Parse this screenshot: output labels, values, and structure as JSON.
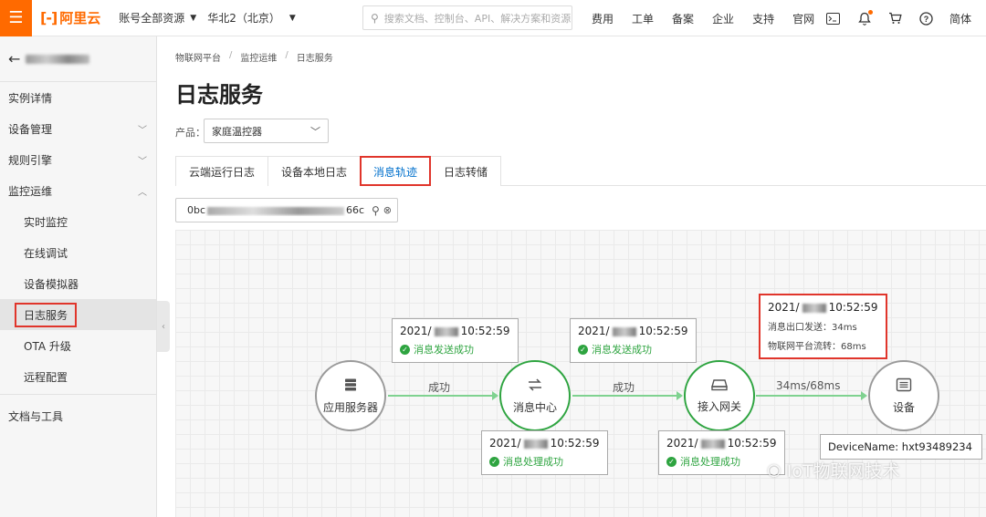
{
  "topbar": {
    "menu_icon": "hamburger-icon",
    "brand": "阿里云",
    "account_scope": "账号全部资源",
    "region": "华北2（北京）",
    "search_placeholder": "搜索文档、控制台、API、解决方案和资源",
    "links": [
      "费用",
      "工单",
      "备案",
      "企业",
      "支持",
      "官网"
    ],
    "icons": [
      "terminal-icon",
      "bell-icon",
      "cart-icon",
      "help-icon"
    ],
    "language": "简体",
    "accent": "#ff6a00"
  },
  "sidebar": {
    "back_icon": "arrow-left-icon",
    "items": [
      {
        "label": "实例详情",
        "level": 1,
        "expandable": false
      },
      {
        "label": "设备管理",
        "level": 1,
        "expandable": true,
        "expanded": false
      },
      {
        "label": "规则引擎",
        "level": 1,
        "expandable": true,
        "expanded": false
      },
      {
        "label": "监控运维",
        "level": 1,
        "expandable": true,
        "expanded": true
      },
      {
        "label": "实时监控",
        "level": 2
      },
      {
        "label": "在线调试",
        "level": 2
      },
      {
        "label": "设备模拟器",
        "level": 2
      },
      {
        "label": "日志服务",
        "level": 2,
        "active": true
      },
      {
        "label": "OTA 升级",
        "level": 2
      },
      {
        "label": "远程配置",
        "level": 2
      },
      {
        "label": "文档与工具",
        "level": 1,
        "expandable": false
      }
    ]
  },
  "breadcrumb": [
    "物联网平台",
    "监控运维",
    "日志服务"
  ],
  "page": {
    "title": "日志服务",
    "product_label": "产品：",
    "product_value": "家庭温控器",
    "tabs": [
      {
        "label": "云端运行日志",
        "active": false
      },
      {
        "label": "设备本地日志",
        "active": false
      },
      {
        "label": "消息轨迹",
        "active": true
      },
      {
        "label": "日志转储",
        "active": false
      }
    ],
    "trace_id_prefix": "0bc",
    "trace_id_suffix": "66c"
  },
  "trace": {
    "nodes": [
      {
        "label": "应用服务器",
        "icon": "server-icon",
        "state": "grey"
      },
      {
        "label": "消息中心",
        "icon": "exchange-icon",
        "state": "green"
      },
      {
        "label": "接入网关",
        "icon": "gateway-icon",
        "state": "green"
      },
      {
        "label": "设备",
        "icon": "device-icon",
        "state": "grey"
      }
    ],
    "edges": [
      "成功",
      "成功",
      "34ms/68ms"
    ],
    "cards": [
      {
        "date_prefix": "2021/",
        "time": "10:52:59",
        "status": "消息发送成功"
      },
      {
        "date_prefix": "2021/",
        "time": "10:52:59",
        "status": "消息处理成功"
      },
      {
        "date_prefix": "2021/",
        "time": "10:52:59",
        "status": "消息发送成功"
      },
      {
        "date_prefix": "2021/",
        "time": "10:52:59",
        "status": "消息处理成功"
      }
    ],
    "latency_card": {
      "date_prefix": "2021/",
      "time": "10:52:59",
      "line1": "消息出口发送：34ms",
      "line2": "物联网平台流转：68ms"
    },
    "device_card": {
      "label": "DeviceName:",
      "value": "hxt93489234"
    }
  },
  "watermark": "IoT物联网技术",
  "colors": {
    "success": "#2ea440",
    "highlight": "#e0352b",
    "link": "#0070cc"
  }
}
